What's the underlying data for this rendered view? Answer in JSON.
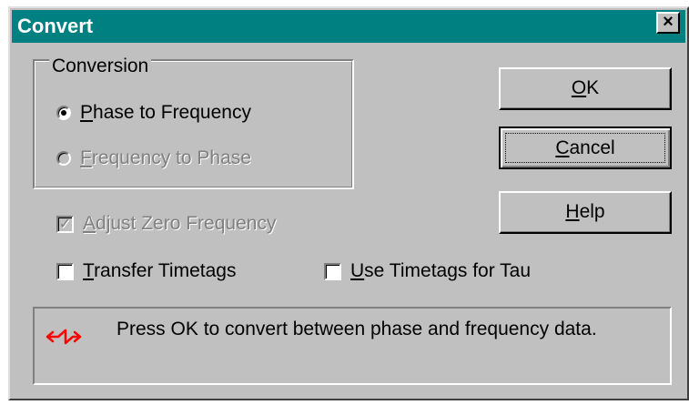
{
  "window": {
    "title": "Convert",
    "close_glyph": "×",
    "titlebar_color": "#008080"
  },
  "conversion": {
    "group_label": "Conversion",
    "options": [
      {
        "mnemonic": "P",
        "rest": "hase to Frequency",
        "selected": true,
        "enabled": true
      },
      {
        "mnemonic": "F",
        "rest": "requency to Phase",
        "selected": false,
        "enabled": false
      }
    ]
  },
  "checkboxes": {
    "adjust_zero": {
      "mnemonic": "A",
      "rest": "djust Zero Frequency",
      "checked": true,
      "enabled": false,
      "check_glyph": "✓"
    },
    "transfer_timetags": {
      "mnemonic": "T",
      "rest": "ransfer Timetags",
      "checked": false,
      "enabled": true
    },
    "use_timetags": {
      "mnemonic": "U",
      "rest": "se Timetags for Tau",
      "checked": false,
      "enabled": true
    }
  },
  "buttons": {
    "ok": {
      "mnemonic": "O",
      "rest": "K"
    },
    "cancel": {
      "mnemonic": "C",
      "rest": "ancel"
    },
    "help": {
      "mnemonic": "H",
      "rest": "elp"
    }
  },
  "info": {
    "icon": "convert-arrows-icon",
    "icon_color": "#ff0000",
    "text": "Press OK to convert between phase and frequency data."
  }
}
